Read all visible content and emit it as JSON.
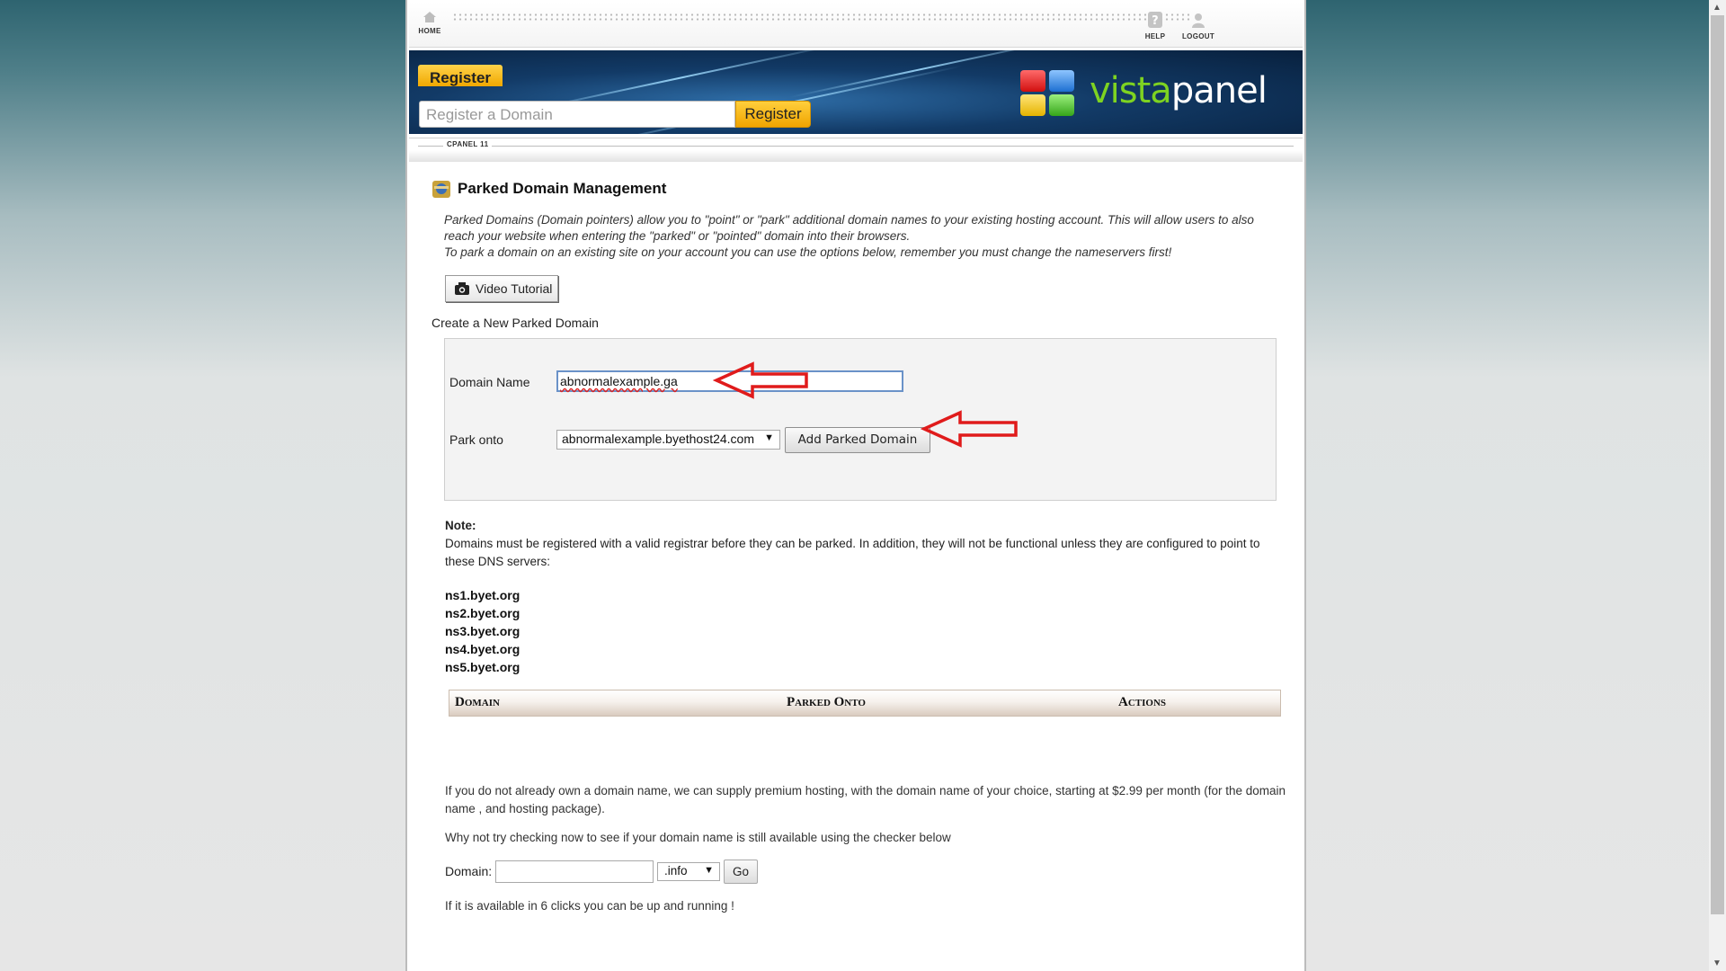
{
  "topbar": {
    "home_label": "HOME",
    "help_label": "HELP",
    "logout_label": "LOGOUT"
  },
  "banner": {
    "register_tab": "Register",
    "register_placeholder": "Register a Domain",
    "register_button": "Register",
    "logo_text_a": "vista",
    "logo_text_b": "panel"
  },
  "cpanel_label": "CPANEL 11",
  "page": {
    "title": "Parked Domain Management",
    "description": [
      "Parked Domains (Domain pointers) allow you to \"point\" or \"park\" additional domain names to your existing hosting account. This will allow users to also reach your website when entering the \"parked\" or \"pointed\" domain into their browsers.",
      "To park a domain on an existing site on your account you can use the options below, remember you must change the nameservers first!"
    ],
    "video_button": "Video Tutorial",
    "create_label": "Create a New Parked Domain"
  },
  "form": {
    "domain_label": "Domain Name",
    "domain_value": "abnormalexample.ga",
    "park_label": "Park onto",
    "park_selected": "abnormalexample.byethost24.com",
    "add_button": "Add Parked Domain"
  },
  "note": {
    "title": "Note:",
    "text": "Domains must be registered with a valid registrar before they can be parked. In addition, they will not be functional unless they are configured to point to these DNS servers:",
    "nameservers": [
      "ns1.byet.org",
      "ns2.byet.org",
      "ns3.byet.org",
      "ns4.byet.org",
      "ns5.byet.org"
    ]
  },
  "table": {
    "columns": [
      "Domain",
      "Parked Onto",
      "Actions"
    ]
  },
  "promo": {
    "line1": "If you do not already own a domain name, we can supply premium hosting, with the domain name of your choice, starting at $2.99 per month (for the domain name , and hosting package).",
    "line2": "Why not try checking now to see if your domain name is still available using the checker below",
    "domain_label": "Domain:",
    "domain_value": "",
    "tld_selected": ".info",
    "go_button": "Go",
    "line3": "If it is available in 6 clicks you can be up and running !"
  },
  "colors": {
    "accent_yellow": "#f0a800",
    "annotation_red": "#e01b1b",
    "banner_blue": "#123a66"
  }
}
